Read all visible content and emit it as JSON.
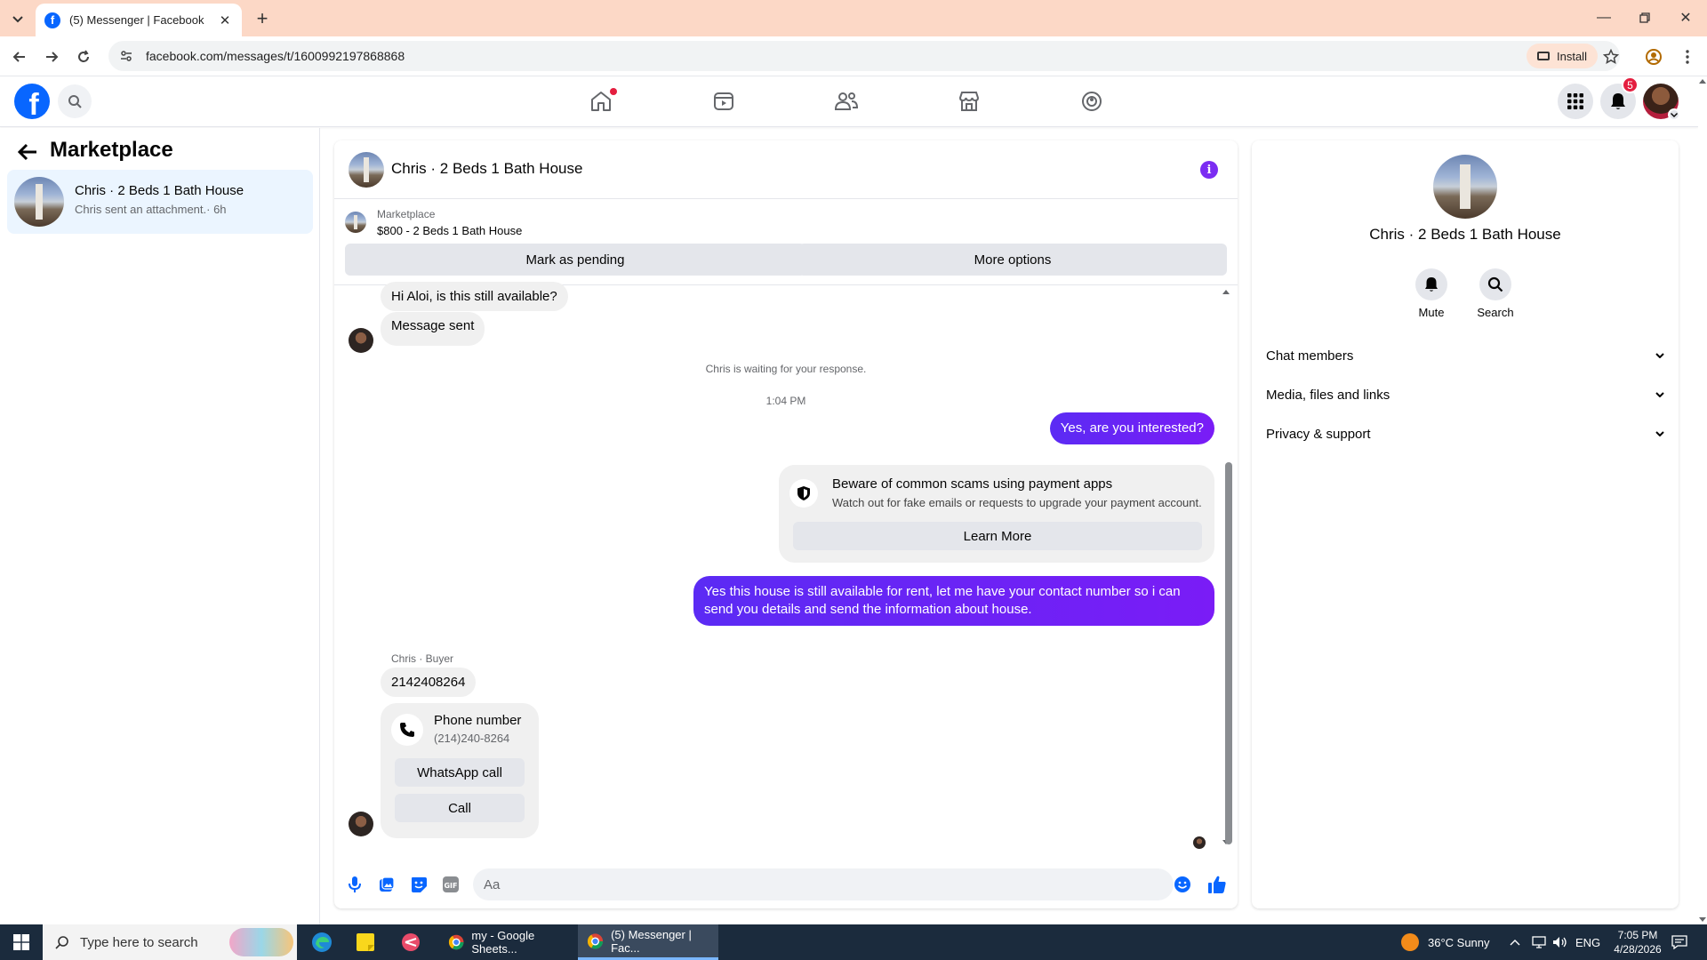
{
  "browser": {
    "tab_title": "(5) Messenger | Facebook",
    "url": "facebook.com/messages/t/1600992197868868",
    "install_label": "Install"
  },
  "header": {
    "notifications_count": "5"
  },
  "sidebar": {
    "title": "Marketplace",
    "conversation": {
      "name": "Chris · 2 Beds 1 Bath House",
      "preview": "Chris sent an attachment.· 6h"
    }
  },
  "chat": {
    "title": "Chris · 2 Beds 1 Bath House",
    "marketplace_label": "Marketplace",
    "listing": "$800 - 2 Beds 1 Bath House",
    "mark_pending_label": "Mark as pending",
    "more_options_label": "More options",
    "messages": {
      "m1": "Hi Aloi, is this still available?",
      "m2": "Message sent",
      "waiting_note": "Chris is waiting for your response.",
      "timestamp": "1:04 PM",
      "m3": "Yes, are you interested?",
      "scam_title": "Beware of common scams using payment apps",
      "scam_sub": "Watch out for fake emails or requests to upgrade your payment account.",
      "learn_more": "Learn More",
      "m4": "Yes this house is still available for rent, let me have your contact number so i can send you details and send the information about house.",
      "sender_label": "Chris · Buyer",
      "m5": "2142408264",
      "phone_title": "Phone number",
      "phone_value": "(214)240-8264",
      "whatsapp_label": "WhatsApp call",
      "call_label": "Call"
    },
    "composer_placeholder": "Aa"
  },
  "right_panel": {
    "name": "Chris · 2 Beds 1 Bath House",
    "mute_label": "Mute",
    "search_label": "Search",
    "sections": [
      "Chat members",
      "Media, files and links",
      "Privacy & support"
    ]
  },
  "taskbar": {
    "search_placeholder": "Type here to search",
    "win1": "my - Google Sheets...",
    "win2": "(5) Messenger | Fac...",
    "weather": "36°C  Sunny",
    "lang": "ENG",
    "time": "7:05 PM",
    "date": "4/28/2026"
  },
  "colors": {
    "fb_blue": "#0866ff",
    "messenger_purple": "#6b21ff",
    "notification_red": "#e41e3f"
  }
}
